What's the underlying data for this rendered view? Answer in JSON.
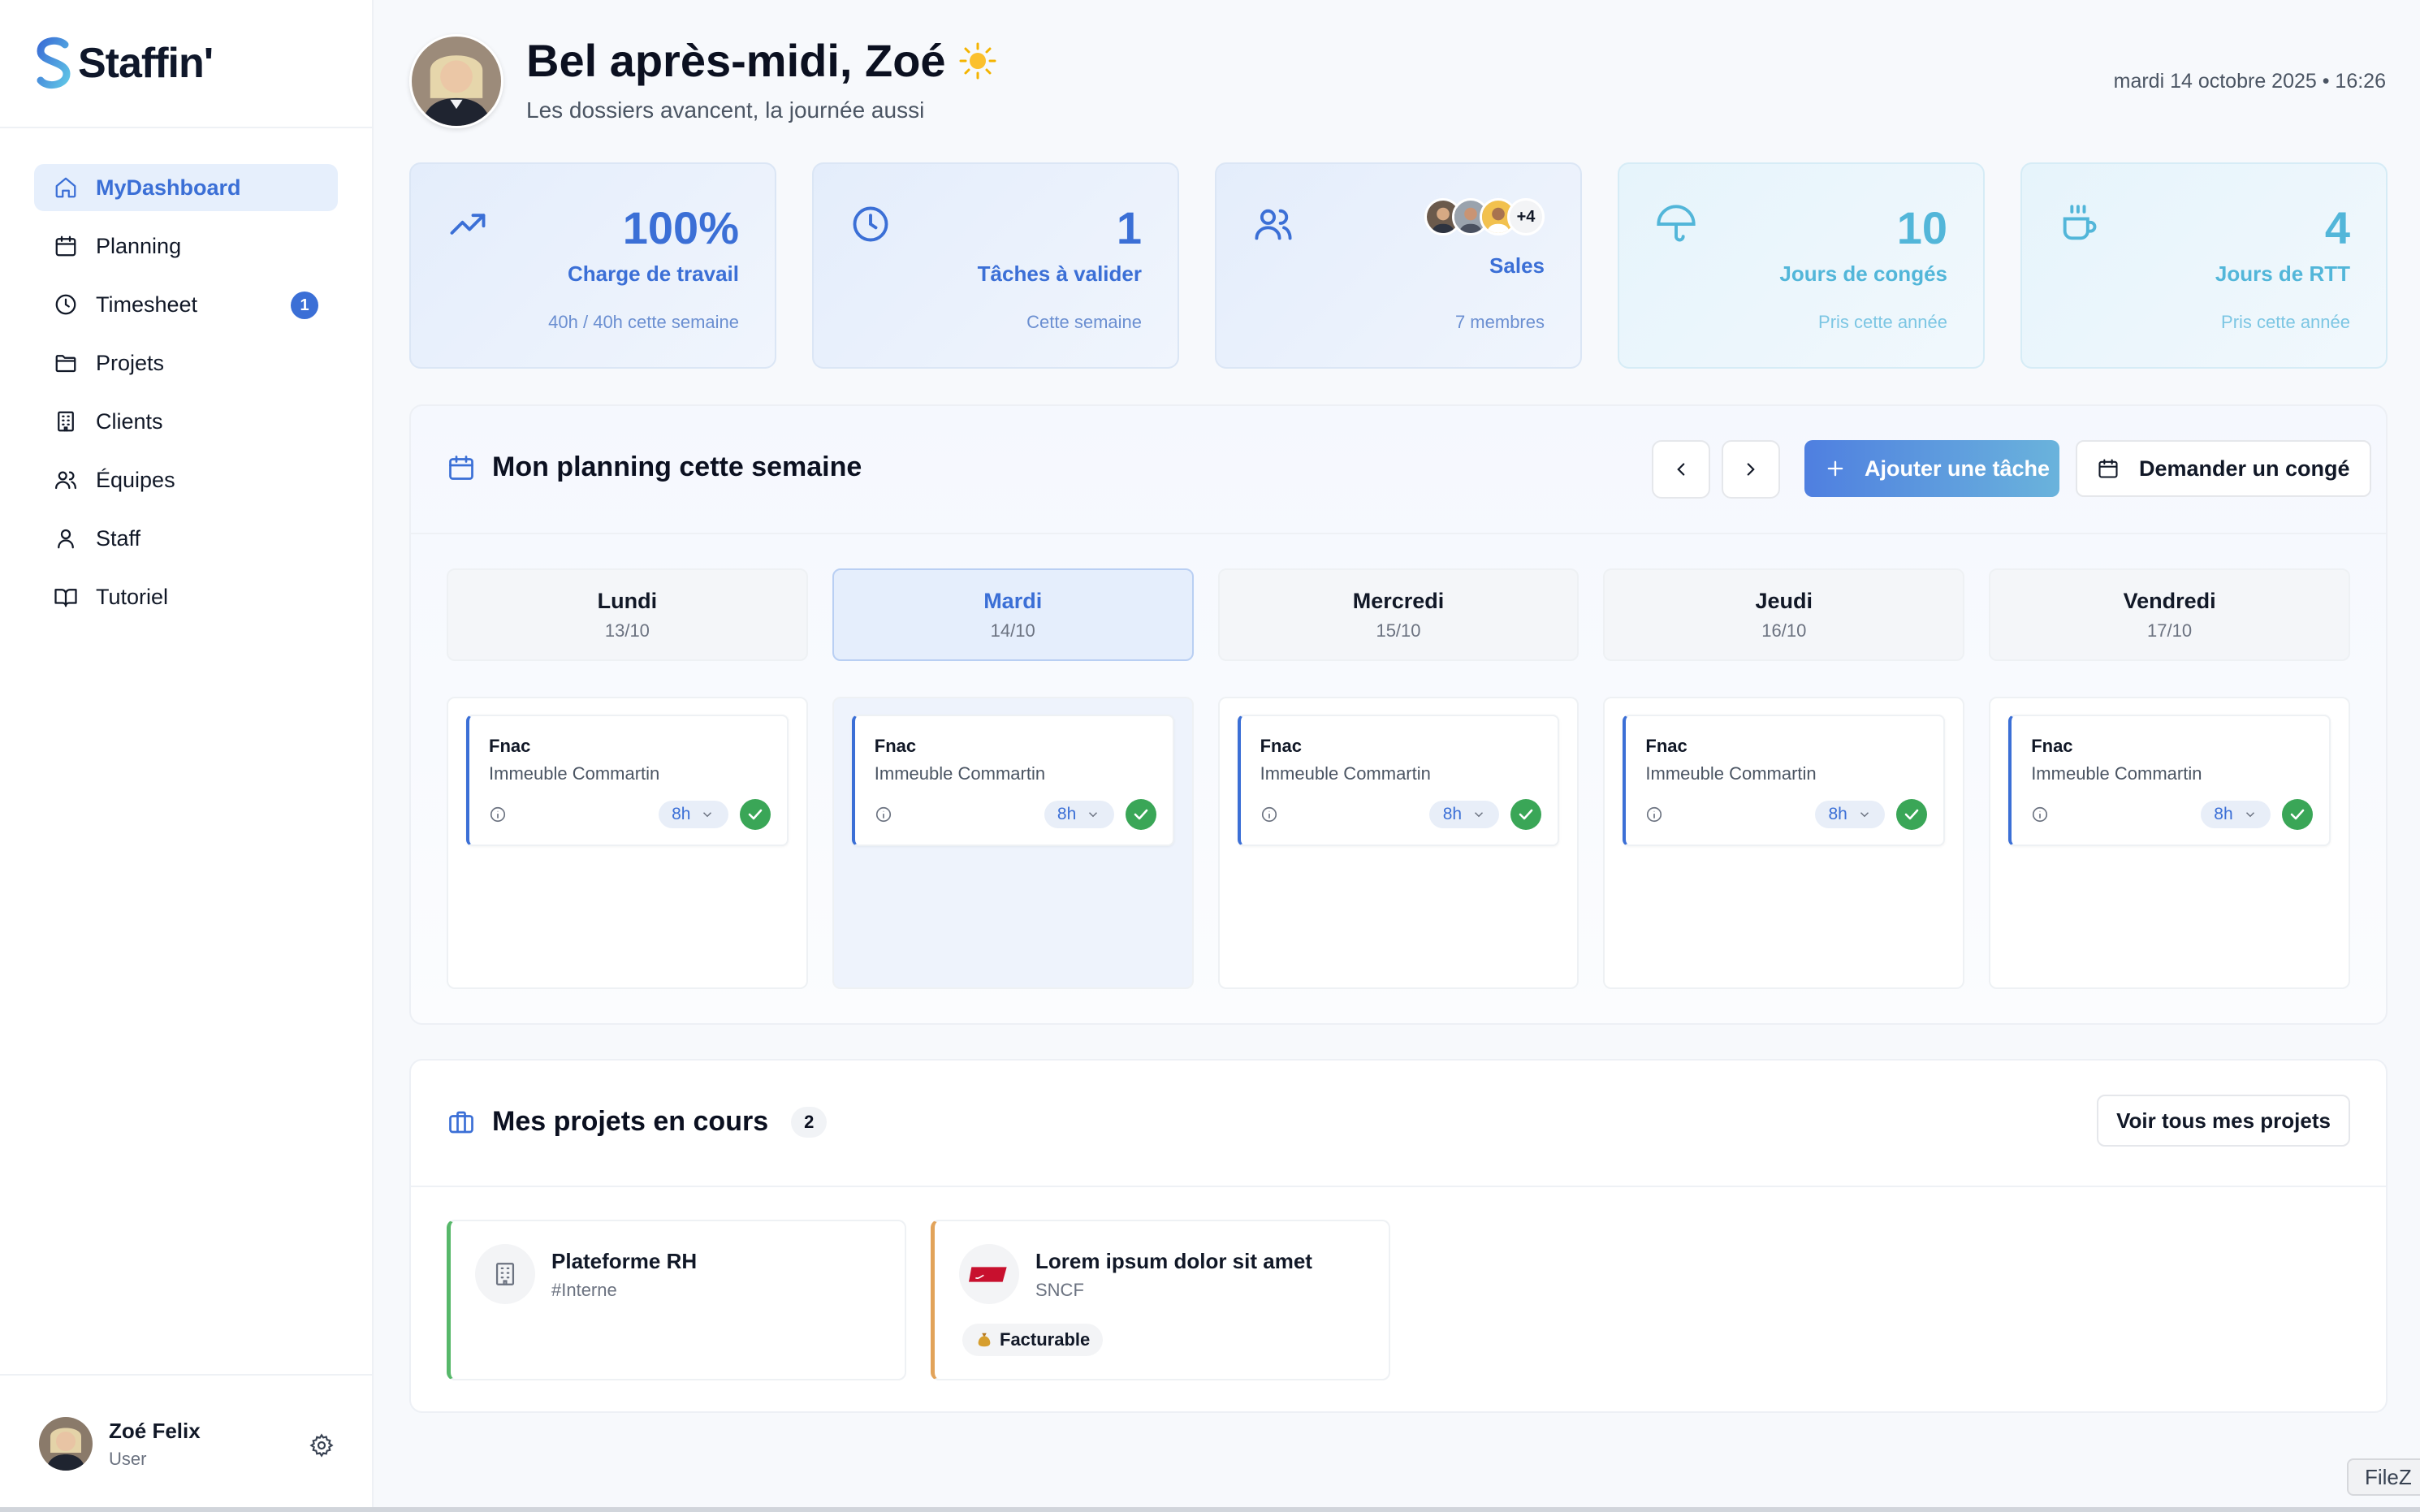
{
  "brand": {
    "name": "Staffin'"
  },
  "nav": [
    {
      "label": "MyDashboard",
      "icon": "home-icon",
      "active": true
    },
    {
      "label": "Planning",
      "icon": "calendar-icon"
    },
    {
      "label": "Timesheet",
      "icon": "clock-icon",
      "badge": "1"
    },
    {
      "label": "Projets",
      "icon": "folder-icon"
    },
    {
      "label": "Clients",
      "icon": "building-icon"
    },
    {
      "label": "Équipes",
      "icon": "users-icon"
    },
    {
      "label": "Staff",
      "icon": "user-icon"
    },
    {
      "label": "Tutoriel",
      "icon": "book-icon"
    }
  ],
  "user": {
    "name": "Zoé Felix",
    "role": "User"
  },
  "header": {
    "greeting": "Bel après-midi, Zoé",
    "subtitle": "Les dossiers avancent, la journée aussi",
    "datetime": "mardi 14 octobre 2025 • 16:26"
  },
  "stats": [
    {
      "icon": "trending-up-icon",
      "value": "100%",
      "label": "Charge de travail",
      "sub": "40h / 40h cette semaine"
    },
    {
      "icon": "clock-icon",
      "value": "1",
      "label": "Tâches à valider",
      "sub": "Cette semaine"
    },
    {
      "icon": "users-icon",
      "more": "+4",
      "label": "Sales",
      "sub": "7 membres"
    },
    {
      "icon": "umbrella-icon",
      "value": "10",
      "label": "Jours de congés",
      "sub": "Pris cette année"
    },
    {
      "icon": "coffee-icon",
      "value": "4",
      "label": "Jours de RTT",
      "sub": "Pris cette année"
    }
  ],
  "planning": {
    "title": "Mon planning cette semaine",
    "add_task": "Ajouter une tâche",
    "request_leave": "Demander un congé",
    "days": [
      {
        "name": "Lundi",
        "date": "13/10",
        "client": "Fnac",
        "project": "Immeuble Commartin",
        "hours": "8h"
      },
      {
        "name": "Mardi",
        "date": "14/10",
        "client": "Fnac",
        "project": "Immeuble Commartin",
        "hours": "8h",
        "active": true
      },
      {
        "name": "Mercredi",
        "date": "15/10",
        "client": "Fnac",
        "project": "Immeuble Commartin",
        "hours": "8h"
      },
      {
        "name": "Jeudi",
        "date": "16/10",
        "client": "Fnac",
        "project": "Immeuble Commartin",
        "hours": "8h"
      },
      {
        "name": "Vendredi",
        "date": "17/10",
        "client": "Fnac",
        "project": "Immeuble Commartin",
        "hours": "8h"
      }
    ]
  },
  "projects": {
    "title": "Mes projets en cours",
    "count": "2",
    "see_all": "Voir tous mes projets",
    "items": [
      {
        "name": "Plateforme RH",
        "tag": "#Interne",
        "logo": "building-icon",
        "accent": "#57b86a"
      },
      {
        "name": "Lorem ipsum dolor sit amet",
        "tag": "SNCF",
        "logo": "sncf-logo",
        "badge": "Facturable",
        "badge_icon": "money-bag-icon",
        "accent": "#e2a35a"
      }
    ]
  },
  "taskbar": {
    "app_label": "FileZ"
  },
  "colors": {
    "primary": "#3b6fd6",
    "teal": "#52b6d9",
    "success": "#3aa657"
  }
}
